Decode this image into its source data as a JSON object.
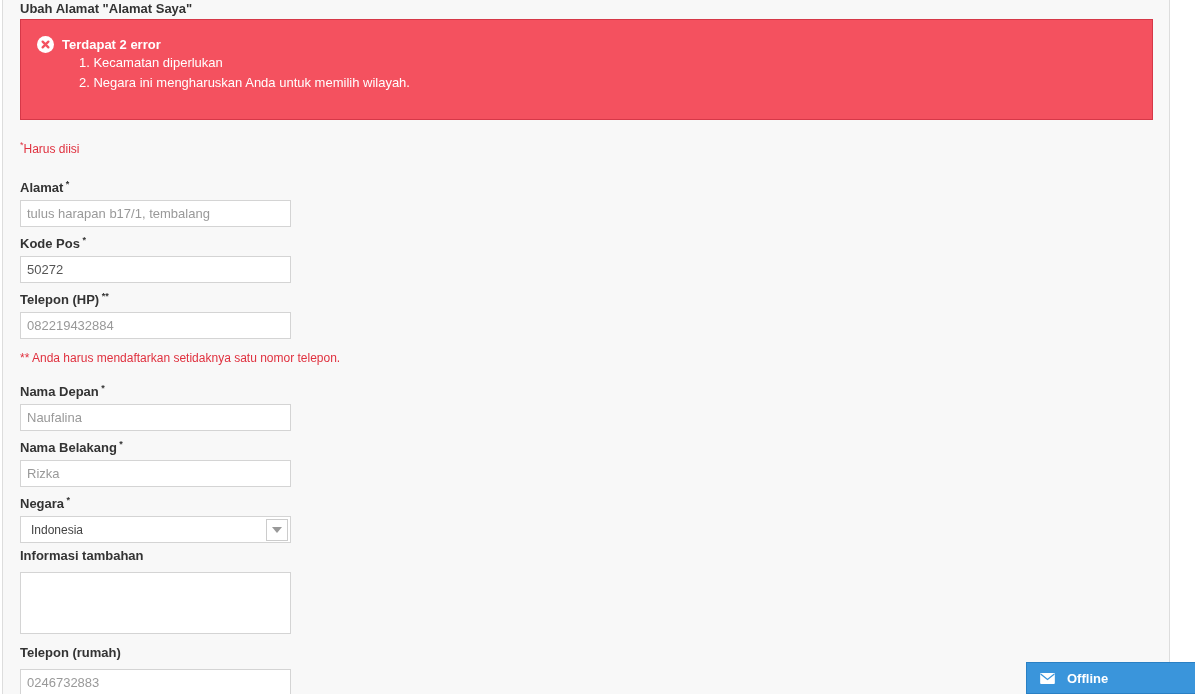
{
  "title": "Ubah Alamat \"Alamat Saya\"",
  "error_box": {
    "heading": "Terdapat 2 error",
    "items": [
      "1. Kecamatan diperlukan",
      "2. Negara ini mengharuskan Anda untuk memilih wilayah."
    ]
  },
  "required_note": {
    "mark": "*",
    "text": "Harus diisi"
  },
  "fields": [
    {
      "kind": "text",
      "label": "Alamat",
      "mark": "*",
      "placeholder": "tulus harapan b17/1, tembalang"
    },
    {
      "kind": "text",
      "label": "Kode Pos",
      "mark": "*",
      "value": "50272"
    },
    {
      "kind": "text",
      "label": "Telepon (HP)",
      "mark": "**",
      "placeholder": "082219432884"
    },
    {
      "kind": "note",
      "text": "** Anda harus mendaftarkan setidaknya satu nomor telepon."
    },
    {
      "kind": "text",
      "label": "Nama Depan",
      "mark": "*",
      "placeholder": "Naufalina"
    },
    {
      "kind": "text",
      "label": "Nama Belakang",
      "mark": "*",
      "placeholder": "Rizka"
    },
    {
      "kind": "select",
      "label": "Negara",
      "mark": "*",
      "value": "Indonesia"
    },
    {
      "kind": "textarea",
      "label": "Informasi tambahan"
    },
    {
      "kind": "text",
      "label": "Telepon (rumah)",
      "placeholder": "0246732883"
    }
  ],
  "chat_widget": {
    "label": "Offline"
  }
}
